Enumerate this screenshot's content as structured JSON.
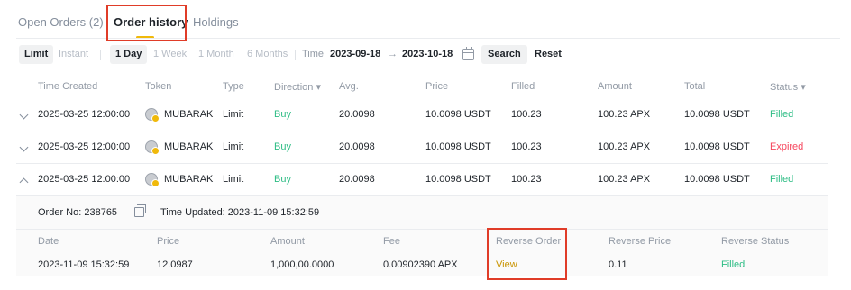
{
  "tabs": [
    {
      "label": "Open Orders (2)"
    },
    {
      "label": "Order history"
    },
    {
      "label": "Holdings"
    }
  ],
  "filters": {
    "type": [
      "Limit",
      "Instant"
    ],
    "periods": [
      "1 Day",
      "1 Week",
      "1 Month",
      "6 Months"
    ],
    "time_label": "Time",
    "start_date": "2023-09-18",
    "arrow": "→",
    "end_date": "2023-10-18",
    "search_label": "Search",
    "reset_label": "Reset"
  },
  "columns": [
    "Time Created",
    "Token",
    "Type",
    "Direction ▾",
    "Avg.",
    "Price",
    "Filled",
    "Amount",
    "Total",
    "Status ▾"
  ],
  "rows": [
    {
      "time": "2025-03-25 12:00:00",
      "token": "MUBARAK",
      "type": "Limit",
      "direction": "Buy",
      "avg": "20.0098",
      "price": "10.0098 USDT",
      "filled": "100.23",
      "amount": "100.23 APX",
      "total": "10.0098 USDT",
      "status": "Filled"
    },
    {
      "time": "2025-03-25 12:00:00",
      "token": "MUBARAK",
      "type": "Limit",
      "direction": "Buy",
      "avg": "20.0098",
      "price": "10.0098 USDT",
      "filled": "100.23",
      "amount": "100.23 APX",
      "total": "10.0098 USDT",
      "status": "Expired"
    },
    {
      "time": "2025-03-25 12:00:00",
      "token": "MUBARAK",
      "type": "Limit",
      "direction": "Buy",
      "avg": "20.0098",
      "price": "10.0098 USDT",
      "filled": "100.23",
      "amount": "100.23 APX",
      "total": "10.0098 USDT",
      "status": "Filled"
    }
  ],
  "detail": {
    "order_no": "Order No: 238765",
    "time_updated": "Time Updated: 2023-11-09 15:32:59",
    "columns": [
      "Date",
      "Price",
      "Amount",
      "Fee",
      "Reverse Order",
      "Reverse Price",
      "Reverse Status"
    ],
    "values": {
      "date": "2023-11-09 15:32:59",
      "price": "12.0987",
      "amount": "1,000,00.0000",
      "fee": "0.00902390 APX",
      "reverse_order": "View",
      "reverse_price": "0.11",
      "reverse_status": "Filled"
    }
  },
  "colors": {
    "accent": "#f0b90b",
    "buy": "#2ebd85",
    "expired": "#f6465d",
    "annotation": "#e03c28"
  }
}
